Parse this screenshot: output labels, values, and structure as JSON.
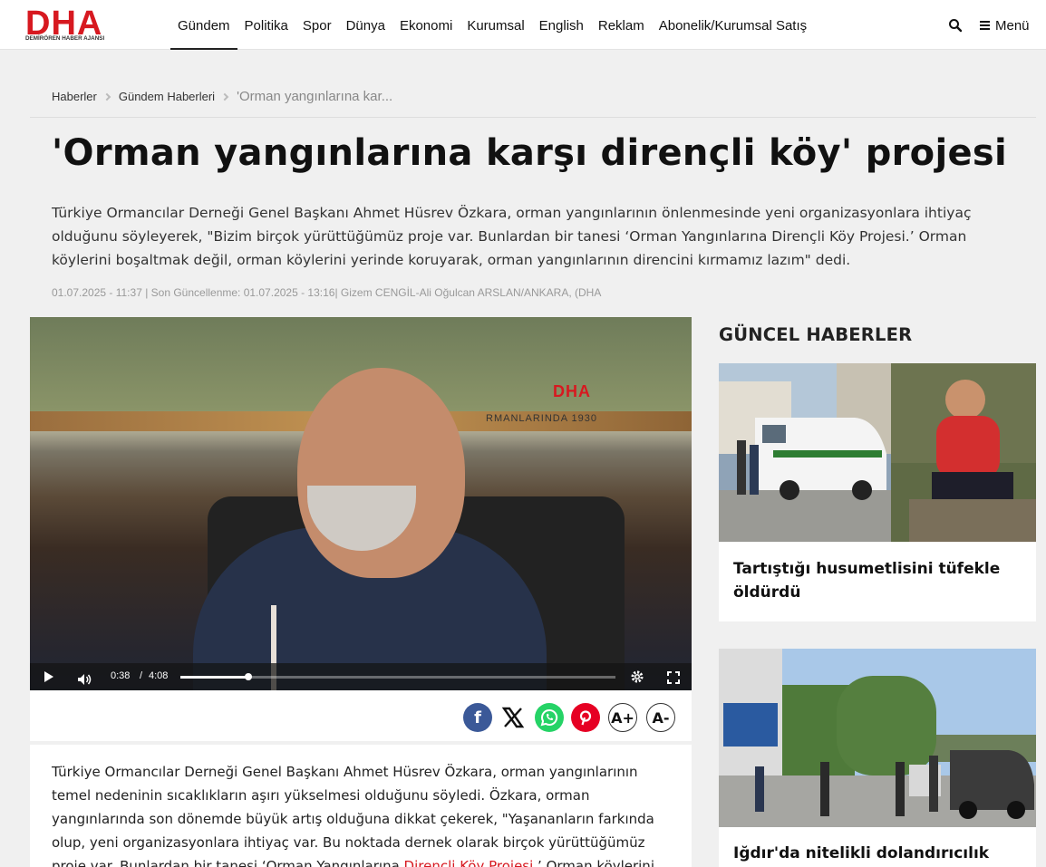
{
  "header": {
    "logo_text": "DHA",
    "logo_subtitle": "DEMİRÖREN HABER AJANSI",
    "nav": [
      "Gündem",
      "Politika",
      "Spor",
      "Dünya",
      "Ekonomi",
      "Kurumsal",
      "English",
      "Reklam",
      "Abonelik/Kurumsal Satış"
    ],
    "active_nav": "Gündem",
    "search_icon": "search-icon",
    "menu_label": "Menü"
  },
  "breadcrumb": {
    "items": [
      "Haberler",
      "Gündem Haberleri"
    ],
    "current": "'Orman yangınlarına kar..."
  },
  "article": {
    "title": "'Orman yangınlarına karşı dirençli köy' projesi",
    "summary": "Türkiye Ormancılar Derneği Genel Başkanı Ahmet Hüsrev Özkara, orman yangınlarının önlenmesinde yeni organizasyonlara ihtiyaç olduğunu söyleyerek, \"Bizim birçok yürüttüğümüz proje var. Bunlardan bir tanesi ‘Orman Yangınlarına Dirençli Köy Projesi.’ Orman köylerini boşaltmak değil, orman köylerini yerinde koruyarak, orman yangınlarının direncini kırmamız lazım\" dedi.",
    "meta": "01.07.2025 - 11:37 | Son Güncellenme: 01.07.2025 - 13:16| Gizem CENGİL-Ali Oğulcan ARSLAN/ANKARA, (DHA",
    "body_before_link": "Türkiye Ormancılar Derneği Genel Başkanı Ahmet Hüsrev Özkara, orman yangınlarının temel nedeninin sıcaklıkların aşırı yükselmesi olduğunu söyledi. Özkara, orman yangınlarında son dönemde büyük artış olduğuna dikkat çekerek, \"Yaşananların farkında olup, yeni organizasyonlara ihtiyaç var. Bu noktada dernek olarak birçok yürüttüğümüz proje var. Bunlardan bir tanesi ‘Orman Yangınlarına ",
    "body_link": "Dirençli Köy Projesi",
    "body_after_link": ".’ Orman köylerini"
  },
  "video": {
    "watermark": "DHA",
    "caption": "RMANLARINDA 1930",
    "time_current": "0:38",
    "time_separator": "/",
    "time_duration": "4:08",
    "progress": 0.156,
    "icons": [
      "play-icon",
      "volume-icon",
      "settings-gear-icon",
      "fullscreen-icon"
    ]
  },
  "share": {
    "buttons": [
      "facebook-icon",
      "x-icon",
      "whatsapp-icon",
      "pinterest-icon",
      "font-increase-icon",
      "font-decrease-icon"
    ],
    "font_plus": "A+",
    "font_minus": "A-",
    "colors": {
      "facebook": "#3b5998",
      "whatsapp": "#25d366",
      "pinterest": "#e60023"
    }
  },
  "sidebar": {
    "title": "GÜNCEL HABERLER",
    "cards": [
      {
        "headline": "Tartıştığı husumetlisini tüfekle öldürdü"
      },
      {
        "headline": "Iğdır'da nitelikli dolandırıcılık"
      }
    ]
  },
  "colors": {
    "brand": "#d71920",
    "background": "#f0f0f0"
  }
}
